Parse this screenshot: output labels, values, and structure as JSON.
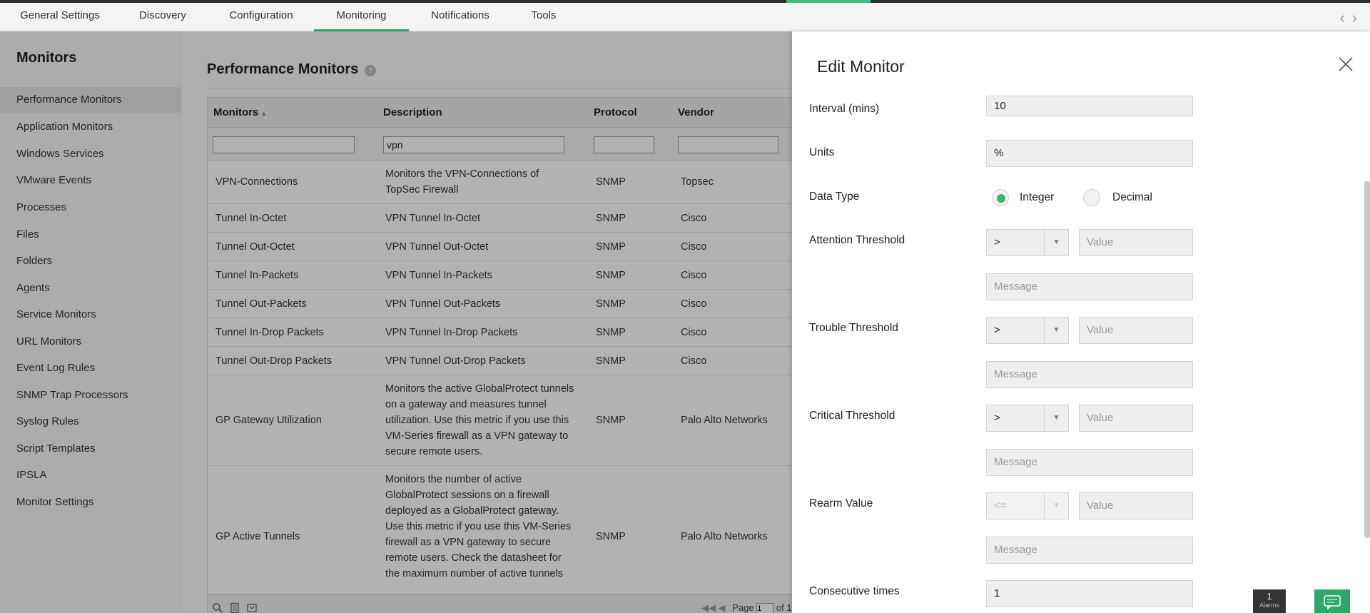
{
  "tabs": [
    {
      "label": "General Settings"
    },
    {
      "label": "Discovery"
    },
    {
      "label": "Configuration"
    },
    {
      "label": "Monitoring",
      "active": true
    },
    {
      "label": "Notifications"
    },
    {
      "label": "Tools"
    }
  ],
  "sidebar": {
    "title": "Monitors",
    "items": [
      {
        "label": "Performance Monitors",
        "active": true
      },
      {
        "label": "Application Monitors"
      },
      {
        "label": "Windows Services"
      },
      {
        "label": "VMware Events"
      },
      {
        "label": "Processes"
      },
      {
        "label": "Files"
      },
      {
        "label": "Folders"
      },
      {
        "label": "Agents"
      },
      {
        "label": "Service Monitors"
      },
      {
        "label": "URL Monitors"
      },
      {
        "label": "Event Log Rules"
      },
      {
        "label": "SNMP Trap Processors"
      },
      {
        "label": "Syslog Rules"
      },
      {
        "label": "Script Templates"
      },
      {
        "label": "IPSLA"
      },
      {
        "label": "Monitor Settings"
      }
    ]
  },
  "main": {
    "title": "Performance Monitors",
    "help": "?",
    "columns": [
      "Monitors",
      "Description",
      "Protocol",
      "Vendor"
    ],
    "filters": {
      "monitors": "",
      "description": "vpn",
      "protocol": "",
      "vendor": ""
    },
    "rows": [
      {
        "monitor": "VPN-Connections",
        "description": "Monitors the VPN-Connections of TopSec Firewall",
        "protocol": "SNMP",
        "vendor": "Topsec"
      },
      {
        "monitor": "Tunnel In-Octet",
        "description": "VPN Tunnel In-Octet",
        "protocol": "SNMP",
        "vendor": "Cisco"
      },
      {
        "monitor": "Tunnel Out-Octet",
        "description": "VPN Tunnel Out-Octet",
        "protocol": "SNMP",
        "vendor": "Cisco"
      },
      {
        "monitor": "Tunnel In-Packets",
        "description": "VPN Tunnel In-Packets",
        "protocol": "SNMP",
        "vendor": "Cisco"
      },
      {
        "monitor": "Tunnel Out-Packets",
        "description": "VPN Tunnel Out-Packets",
        "protocol": "SNMP",
        "vendor": "Cisco"
      },
      {
        "monitor": "Tunnel In-Drop Packets",
        "description": "VPN Tunnel In-Drop Packets",
        "protocol": "SNMP",
        "vendor": "Cisco"
      },
      {
        "monitor": "Tunnel Out-Drop Packets",
        "description": "VPN Tunnel Out-Drop Packets",
        "protocol": "SNMP",
        "vendor": "Cisco"
      },
      {
        "monitor": "GP Gateway Utilization",
        "description": "Monitors the active GlobalProtect tunnels on a gateway and measures tunnel utilization. Use this metric if you use this VM-Series firewall as a VPN gateway to secure remote users.",
        "protocol": "SNMP",
        "vendor": "Palo Alto Networks"
      },
      {
        "monitor": "GP Active Tunnels",
        "description": "Monitors the number of active GlobalProtect sessions on a firewall deployed as a GlobalProtect gateway. Use this metric if you use this VM-Series firewall as a VPN gateway to secure remote users. Check the datasheet for the maximum number of active tunnels",
        "protocol": "SNMP",
        "vendor": "Palo Alto Networks"
      }
    ],
    "pager": {
      "label": "Page",
      "page": "1",
      "of": "of 1"
    }
  },
  "panel": {
    "title": "Edit Monitor",
    "interval_label": "Interval (mins)",
    "interval_value": "10",
    "units_label": "Units",
    "units_value": "%",
    "datatype_label": "Data Type",
    "datatype_integer": "Integer",
    "datatype_decimal": "Decimal",
    "datatype_selected": "Integer",
    "attention_label": "Attention Threshold",
    "trouble_label": "Trouble Threshold",
    "critical_label": "Critical Threshold",
    "rearm_label": "Rearm Value",
    "consecutive_label": "Consecutive times",
    "consecutive_value": "1",
    "op_gt": ">",
    "op_le": "<=",
    "value_placeholder": "Value",
    "message_placeholder": "Message"
  },
  "alarms": {
    "count": "1",
    "label": "Alarms"
  },
  "colors": {
    "accent": "#2ea66b",
    "radio_on": "#3bb371",
    "chat": "#2fa66a"
  }
}
